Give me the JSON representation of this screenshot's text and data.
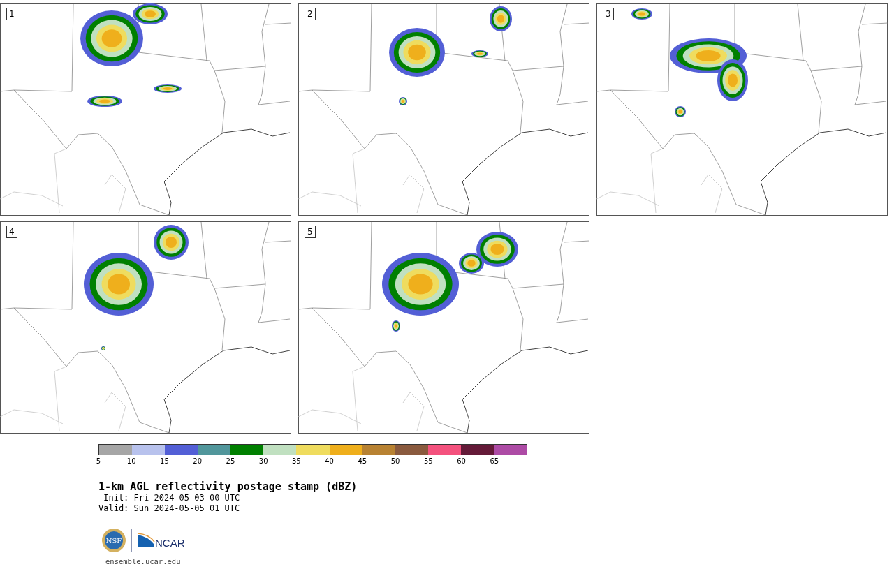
{
  "panels": [
    {
      "label": "1"
    },
    {
      "label": "2"
    },
    {
      "label": "3"
    },
    {
      "label": "4"
    },
    {
      "label": "5"
    }
  ],
  "colorbar": {
    "segments": [
      {
        "color": "#a6a6a6"
      },
      {
        "color": "#b8c2ed"
      },
      {
        "color": "#535fd6"
      },
      {
        "color": "#51969b"
      },
      {
        "color": "#008000"
      },
      {
        "color": "#c0e0c0"
      },
      {
        "color": "#efdc5e"
      },
      {
        "color": "#efaf1c"
      },
      {
        "color": "#b88232"
      },
      {
        "color": "#8a5a3e"
      },
      {
        "color": "#f4527e"
      },
      {
        "color": "#641a38"
      },
      {
        "color": "#ad4ba5"
      }
    ],
    "ticks": [
      "5",
      "10",
      "15",
      "20",
      "25",
      "30",
      "35",
      "40",
      "45",
      "50",
      "55",
      "60",
      "65"
    ]
  },
  "title": "1-km AGL reflectivity postage stamp (dBZ)",
  "init": " Init: Fri 2024-05-03 00 UTC",
  "valid": "Valid: Sun 2024-05-05 01 UTC",
  "logos": {
    "nsf": "NSF",
    "ncar": "NCAR"
  },
  "url": "ensemble.ucar.edu"
}
